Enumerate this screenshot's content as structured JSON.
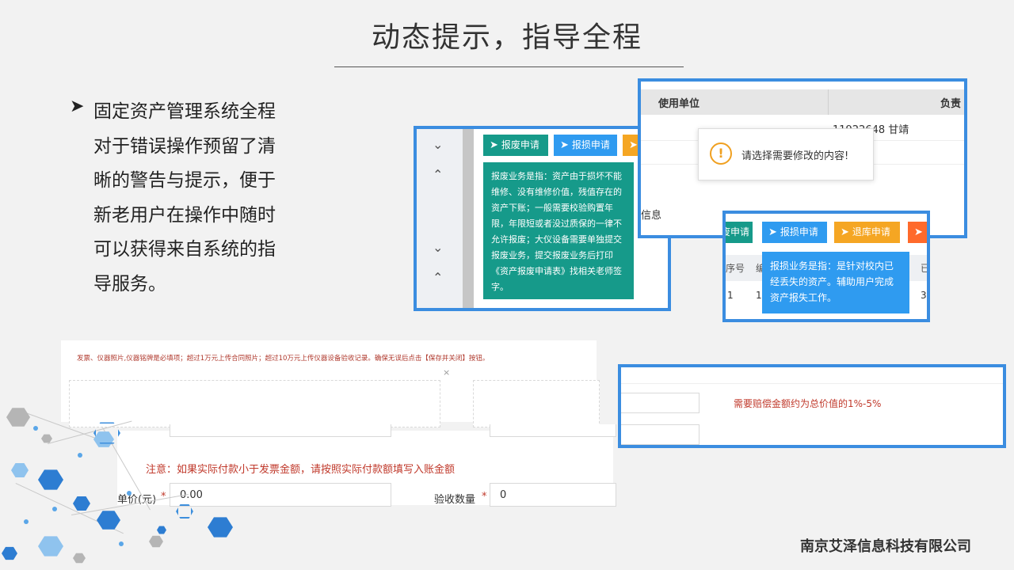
{
  "slide": {
    "title": "动态提示，指导全程",
    "bullet_text": "固定资产管理系统全程对于错误操作预留了清晰的警告与提示，便于新老用户在操作中随时可以获得来自系统的指导服务。",
    "company": "南京艾泽信息科技有限公司"
  },
  "panel1": {
    "buttons": [
      "报废申请",
      "报损申请"
    ],
    "tooltip": "报废业务是指：资产由于损坏不能维修、没有维修价值，残值存在的资产下账；一般需要校验购置年限，年限短或者没过质保的一律不允许报废；大仪设备需要单独提交报废业务，提交报废业务后打印《资产报废申请表》找相关老师签字。"
  },
  "panel2": {
    "col_unit": "使用单位",
    "col_owner": "负责",
    "cell_owner": "11922648 甘靖",
    "partial_text": "信息",
    "dialog_icon": "!",
    "dialog_text": "请选择需要修改的内容!"
  },
  "panel3": {
    "partial_btn": "废申请",
    "buttons": [
      "报损申请",
      "退库申请"
    ],
    "col_partial_1": "序号",
    "col_partial_2": "编",
    "col_partial_3": "已",
    "row_partial_1": "1",
    "row_partial_2": "1",
    "row_partial_3": "3",
    "tooltip": "报损业务是指：是针对校内已经丢失的资产。辅助用户完成资产报失工作。"
  },
  "form1": {
    "notice": "发票、仪器照片,仪器铭牌是必填项；超过1万元上传合同照片；超过10万元上传仪器设备验收记录。确保无误后点击【保存并关闭】按钮。",
    "close": "×"
  },
  "form2": {
    "notice": "注意：如果实际付款小于发票金额，请按照实际付款额填写入账金额",
    "price_label": "单价(元)",
    "price_value": "0.00",
    "qty_label": "验收数量",
    "qty_value": "0",
    "required_mark": "*"
  },
  "panel4": {
    "notice": "需要赔偿金额约为总价值的1%-5%"
  },
  "colors": {
    "accent": "#3b8de0",
    "teal": "#169a8a",
    "blue_btn": "#2f9bf0",
    "orange_btn": "#f5a623",
    "red_orange": "#ff6a2b",
    "warning": "#f0a020"
  }
}
